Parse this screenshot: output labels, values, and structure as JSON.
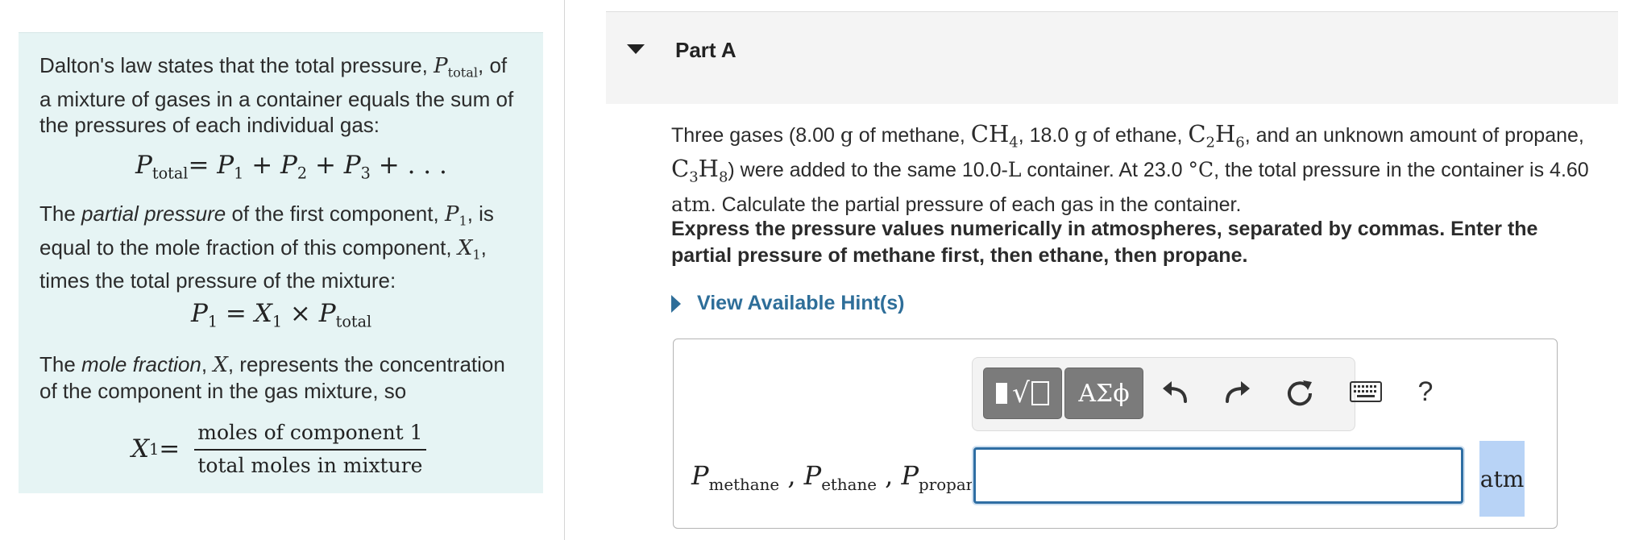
{
  "left_panel": {
    "intro": {
      "t1": "Dalton's law states that the total pressure, ",
      "sym": "P",
      "sub": "total",
      "t2": ", of a mixture of gases in a container equals the sum of the pressures of each individual gas:"
    },
    "eq1": {
      "lhs": "P",
      "lhs_sub": "total",
      "rhs": "= P",
      "s1": "1",
      "p2": " + P",
      "s2": "2",
      "p3": " + P",
      "s3": "3",
      "tail": " + . . ."
    },
    "partial": {
      "t1": "The ",
      "em": "partial pressure",
      "t2": " of the first component, ",
      "sym1": "P",
      "sub1": "1",
      "t3": ", is equal to the mole fraction of this component, ",
      "sym2": "X",
      "sub2": "1",
      "t4": ", times the total pressure of the mixture:"
    },
    "eq2": {
      "lhs": "P",
      "lhs_sub": "1",
      "mid": " = X",
      "mid_sub": "1",
      "times": " × P",
      "rhs_sub": "total"
    },
    "molefrac": {
      "t1": "The ",
      "em": "mole fraction",
      "t2": ", ",
      "sym": "X",
      "t3": ", represents the concentration of the component in the gas mixture, so"
    },
    "eq3": {
      "lhs": "X",
      "lhs_sub": "1",
      "eq": " =",
      "numerator": "moles of component 1",
      "denominator": "total moles in mixture"
    }
  },
  "part": {
    "title": "Part A"
  },
  "question": {
    "a": "Three gases (8.00 ",
    "u_g1": "g",
    "b": " of methane, ",
    "ch4_c": "CH",
    "ch4_4": "4",
    "c": ", 18.0 ",
    "u_g2": "g",
    "d": " of ethane, ",
    "c2h6_c": "C",
    "c2h6_2": "2",
    "c2h6_h": "H",
    "c2h6_6": "6",
    "e": ", and an unknown amount of propane, ",
    "c3h8_c": "C",
    "c3h8_3": "3",
    "c3h8_h": "H",
    "c3h8_8": "8",
    "f": ") were added to the same 10.0-",
    "u_L": "L",
    "g": " container. At 23.0 ",
    "u_C": "°C",
    "h": ", the total pressure in the container is 4.60 ",
    "u_atm": "atm",
    "i": ". Calculate the partial pressure of each gas in the container."
  },
  "instruction": "Express the pressure values numerically in atmospheres, separated by commas. Enter the partial pressure of methane first, then ethane, then propane.",
  "hint": {
    "label": "View Available Hint(s)"
  },
  "toolbar": {
    "symbols_label": "ΑΣϕ",
    "help_label": "?"
  },
  "answer": {
    "p1": "P",
    "p1_sub": "methane",
    "sep1": " , ",
    "p2": "P",
    "p2_sub": "ethane",
    "sep2": " , ",
    "p3": "P",
    "p3_sub": "propane",
    "input_value": "",
    "unit": "atm"
  },
  "colors": {
    "panel_bg": "#e6f4f4",
    "link": "#2e6e99",
    "input_border": "#2f6ea3",
    "unit_highlight": "#b8d3f6"
  }
}
